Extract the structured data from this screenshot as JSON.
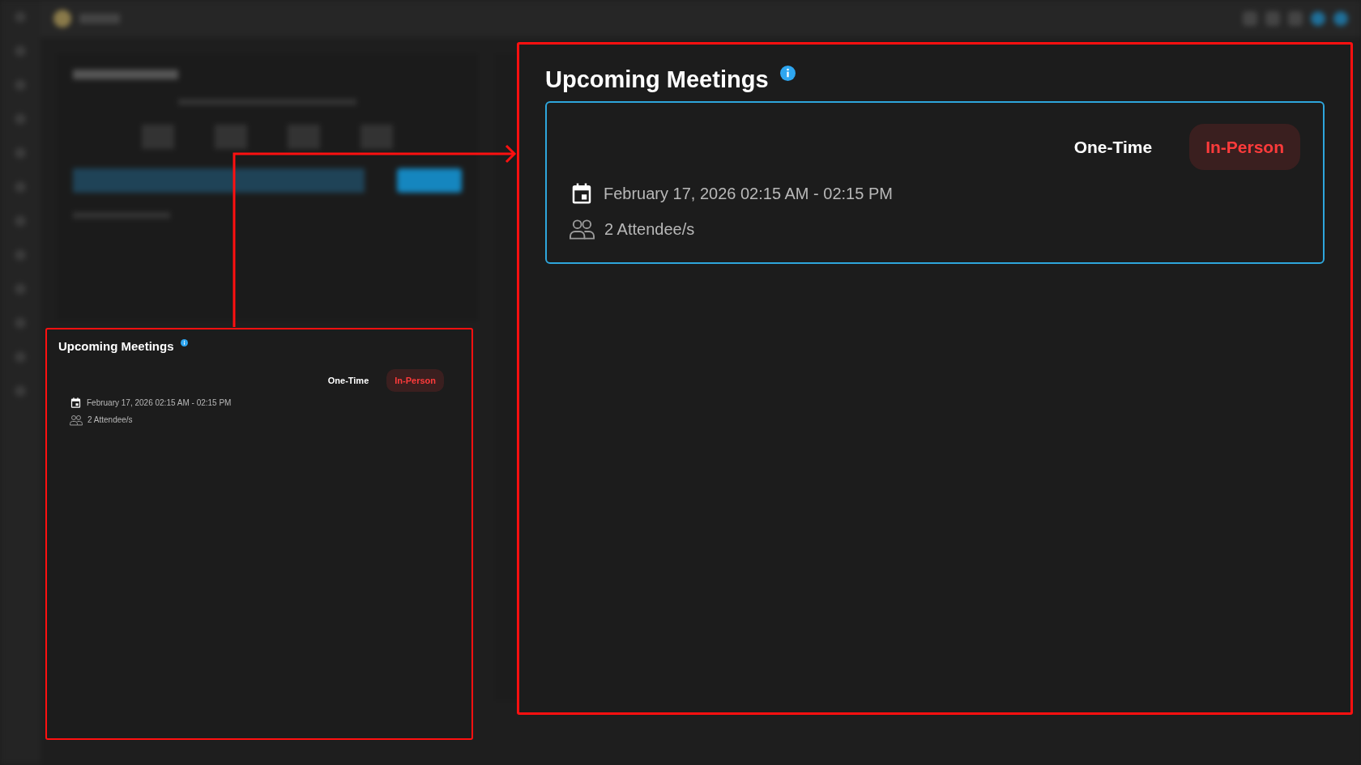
{
  "original_panel": {
    "title": "Upcoming Meetings",
    "meetings": [
      {
        "frequency": "One-Time",
        "type": "In-Person",
        "datetime": "February 17, 2026 02:15 AM - 02:15 PM",
        "attendees": "2 Attendee/s"
      }
    ]
  },
  "magnified_panel": {
    "title": "Upcoming Meetings",
    "meetings": [
      {
        "frequency": "One-Time",
        "type": "In-Person",
        "datetime": "February 17, 2026 02:15 AM - 02:15 PM",
        "attendees": "2 Attendee/s"
      }
    ]
  }
}
